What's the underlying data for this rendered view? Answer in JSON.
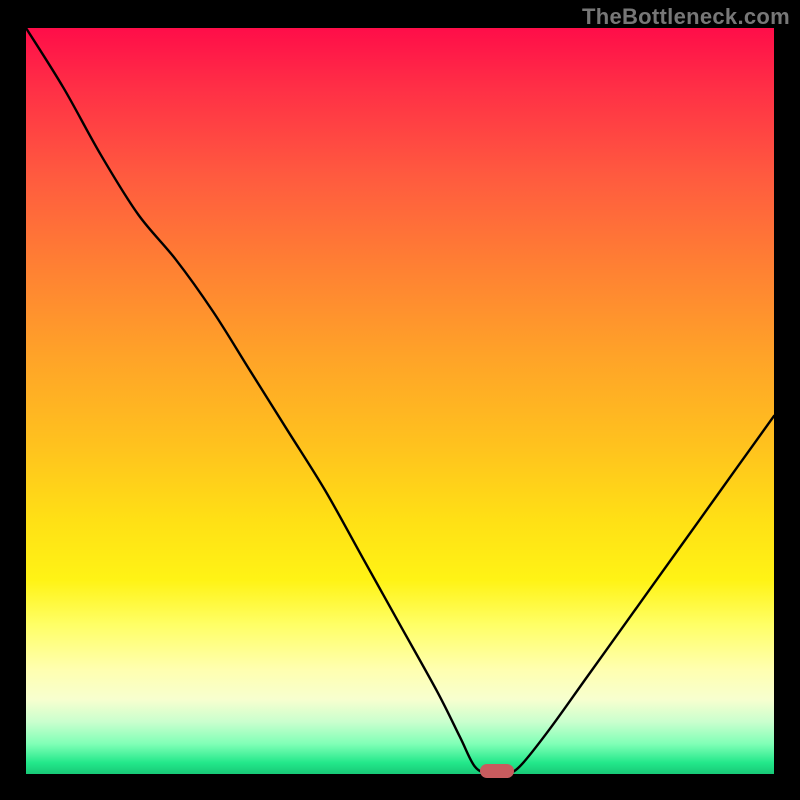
{
  "attribution": "TheBottleneck.com",
  "colors": {
    "background": "#000000",
    "gradient_top": "#ff0d49",
    "gradient_mid": "#ffe015",
    "gradient_bottom": "#18c877",
    "curve": "#000000",
    "marker": "#c85b5e",
    "attribution_text": "#777777"
  },
  "chart_data": {
    "type": "line",
    "title": "",
    "xlabel": "",
    "ylabel": "",
    "xlim": [
      0,
      100
    ],
    "ylim": [
      0,
      100
    ],
    "grid": false,
    "legend": false,
    "series": [
      {
        "name": "bottleneck-curve",
        "x": [
          0,
          5,
          10,
          15,
          20,
          25,
          30,
          35,
          40,
          45,
          50,
          55,
          58,
          60,
          62,
          64,
          66,
          70,
          75,
          80,
          85,
          90,
          95,
          100
        ],
        "y": [
          100,
          92,
          83,
          75,
          69,
          62,
          54,
          46,
          38,
          29,
          20,
          11,
          5,
          1,
          0,
          0,
          1,
          6,
          13,
          20,
          27,
          34,
          41,
          48
        ]
      }
    ],
    "marker": {
      "x": 63,
      "y": 0,
      "shape": "rounded-rect"
    },
    "notes": "Values estimated from pixel positions; y represents percentage height from bottom (0) to top (100). X in percent of plot width."
  }
}
